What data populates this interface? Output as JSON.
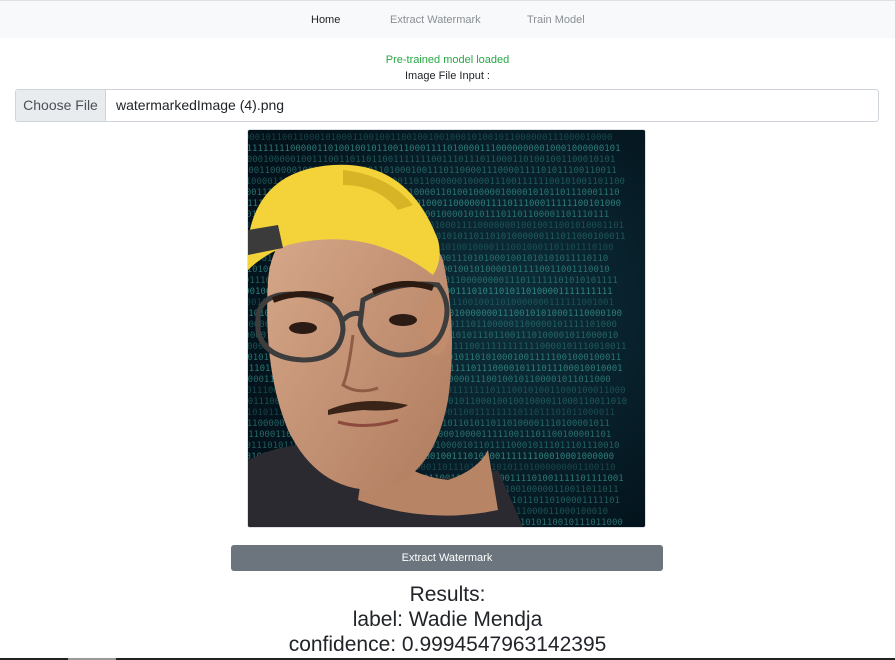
{
  "nav": {
    "items": [
      {
        "label": "Home",
        "active": true
      },
      {
        "label": "Extract Watermark",
        "active": false
      },
      {
        "label": "Train Model",
        "active": false
      }
    ]
  },
  "status": {
    "model_loaded": "Pre-trained model loaded",
    "file_input_label": "Image File Input :"
  },
  "file_input": {
    "button_label": "Choose File",
    "file_name": "watermarkedImage (4).png"
  },
  "actions": {
    "extract_label": "Extract Watermark"
  },
  "results": {
    "title": "Results:",
    "label_text": "label: Wadie Mendja",
    "confidence_text": "confidence: 0.9994547963142395"
  },
  "colors": {
    "status_green": "#28a745",
    "button_gray": "#6c757d",
    "cap_yellow": "#f4d23a",
    "matrix_green": "#3fa9a0"
  }
}
